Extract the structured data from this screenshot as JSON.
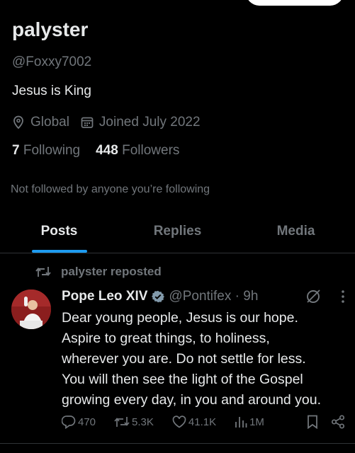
{
  "profile": {
    "name": "palyster",
    "handle": "@Foxxy7002",
    "bio": "Jesus is King",
    "location": "Global",
    "joined": "Joined July 2022",
    "following_count": "7",
    "following_label": "Following",
    "followers_count": "448",
    "followers_label": "Followers",
    "not_followed": "Not followed by anyone you’re following"
  },
  "tabs": [
    {
      "label": "Posts",
      "active": true
    },
    {
      "label": "Replies",
      "active": false
    },
    {
      "label": "Media",
      "active": false
    }
  ],
  "post": {
    "repost_label": "palyster reposted",
    "author": "Pope Leo XIV",
    "handle_time": "@Pontifex · 9h",
    "text_lines": [
      "Dear young people, Jesus is our hope.",
      "Aspire to great things, to holiness,",
      "wherever you are. Do not settle for less.",
      "You will then see the light of the Gospel",
      "growing every day, in you and around you."
    ],
    "replies": "470",
    "reposts": "5.3K",
    "likes": "41.1K",
    "views": "1M"
  },
  "colors": {
    "accent": "#1d9bf0",
    "muted": "#71767b",
    "text": "#e7e9ea",
    "verified": "#829aab"
  },
  "icons": [
    "location-icon",
    "calendar-icon",
    "repost-icon",
    "verified-badge-icon",
    "grok-icon",
    "more-icon",
    "reply-icon",
    "like-icon",
    "views-icon",
    "bookmark-icon",
    "share-icon"
  ]
}
